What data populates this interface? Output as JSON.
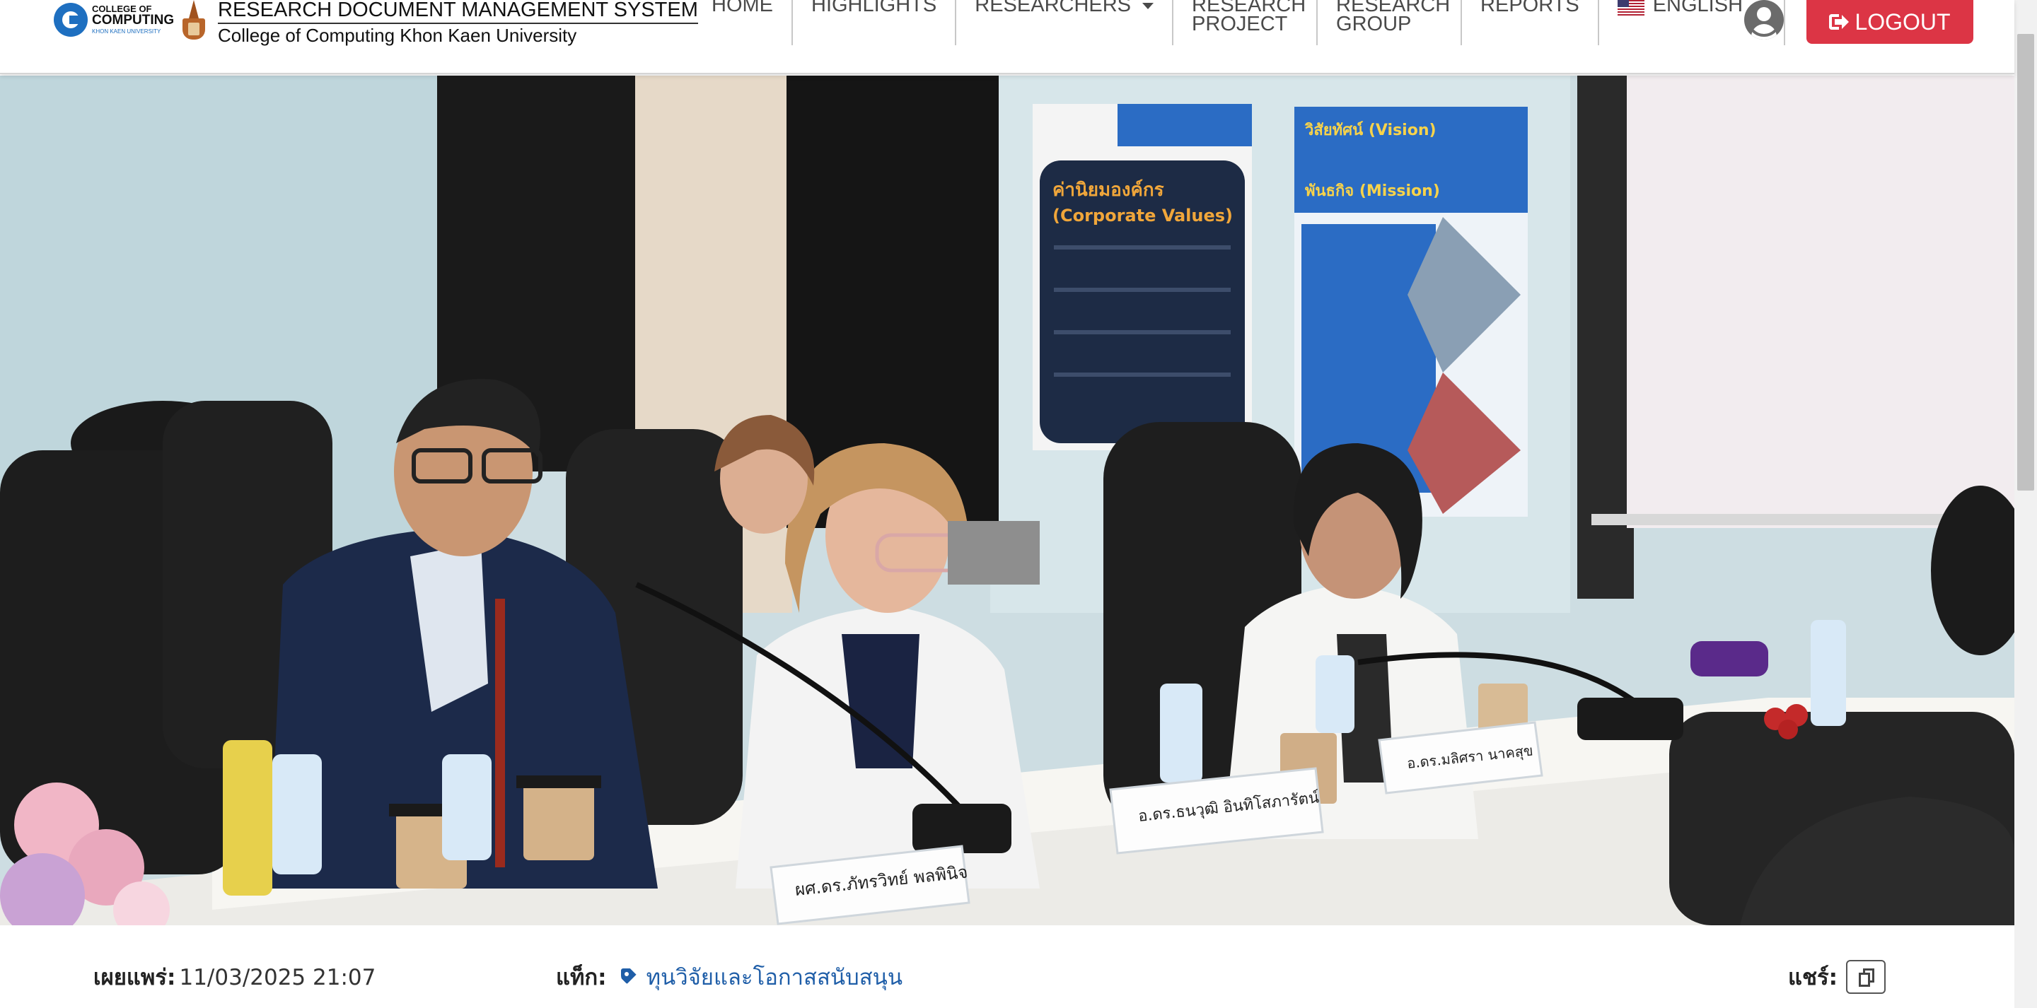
{
  "header": {
    "logo_college_line1": "COLLEGE OF",
    "logo_college_line2": "COMPUTING",
    "logo_college_line3": "KHON KAEN UNIVERSITY",
    "title": "RESEARCH DOCUMENT MANAGEMENT SYSTEM",
    "subtitle": "College of Computing Khon Kaen University"
  },
  "nav": {
    "home": "HOME",
    "highlights": "HIGHLIGHTS",
    "researchers": "RESEARCHERS",
    "research_project": "RESEARCH PROJECT",
    "research_group": "RESEARCH GROUP",
    "reports": "REPORTS",
    "language": "ENGLISH",
    "logout": "LOGOUT"
  },
  "hero": {
    "icon": "meeting-photo",
    "poster_left_title": "ค่านิยมองค์กร",
    "poster_left_subtitle": "(Corporate Values)",
    "poster_right_title": "วิสัยทัศน์ (Vision)",
    "poster_right_subtitle": "พันธกิจ (Mission)",
    "nameplate_1": "ผศ.ดร.ภัทรวิทย์ พลพินิจ",
    "nameplate_2": "อ.ดร.ธนวุฒิ อินทิโสภารัตน์",
    "nameplate_3": "อ.ดร.มลิศรา นาคสุข"
  },
  "meta": {
    "published_label": "เผยแพร่:",
    "published_value": "11/03/2025 21:07",
    "tags_label": "แท็ก:",
    "tag_1": "ทุนวิจัยและโอกาสสนับสนุน",
    "share_label": "แชร์:"
  },
  "colors": {
    "logout_bg": "#dc3545",
    "tag_link": "#1f5ea8",
    "brand_blue": "#1e6fc0"
  }
}
